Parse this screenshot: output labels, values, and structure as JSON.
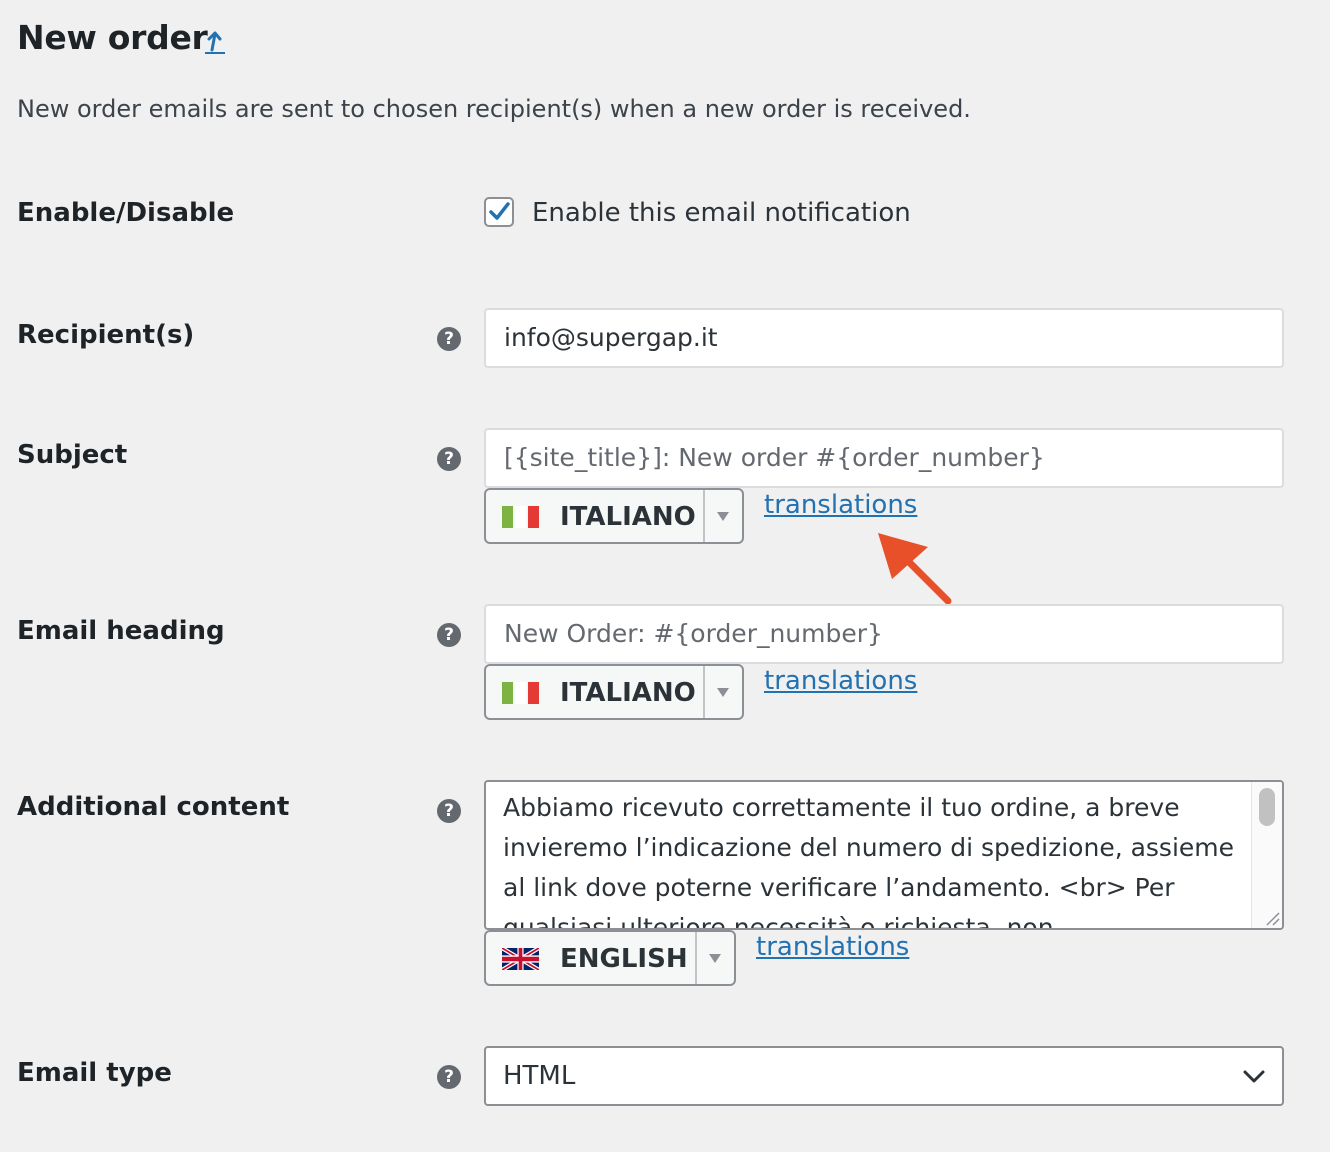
{
  "section": {
    "title": "New order",
    "description": "New order emails are sent to chosen recipient(s) when a new order is received."
  },
  "fields": {
    "enable": {
      "label": "Enable/Disable",
      "checkbox_label": "Enable this email notification",
      "checked": true
    },
    "recipient": {
      "label": "Recipient(s)",
      "help": "?",
      "value": "info@supergap.it"
    },
    "subject": {
      "label": "Subject",
      "help": "?",
      "placeholder": "[{site_title}]: New order #{order_number}",
      "language": "ITALIANO",
      "translations_link": "translations"
    },
    "email_heading": {
      "label": "Email heading",
      "help": "?",
      "placeholder": "New Order: #{order_number}",
      "language": "ITALIANO",
      "translations_link": "translations"
    },
    "additional_content": {
      "label": "Additional content",
      "help": "?",
      "value": "Abbiamo ricevuto correttamente il tuo ordine, a breve invieremo l’indicazione del numero di spedizione, assieme al link dove poterne verificare l’andamento. <br> Per qualsiasi ulteriore necessità o richiesta, non",
      "language": "ENGLISH",
      "translations_link": "translations"
    },
    "email_type": {
      "label": "Email type",
      "help": "?",
      "value": "HTML"
    }
  },
  "colors": {
    "background": "#f0f0f1",
    "link": "#2271b1",
    "checkmark": "#2271b1",
    "annotation_arrow": "#e8502a"
  }
}
